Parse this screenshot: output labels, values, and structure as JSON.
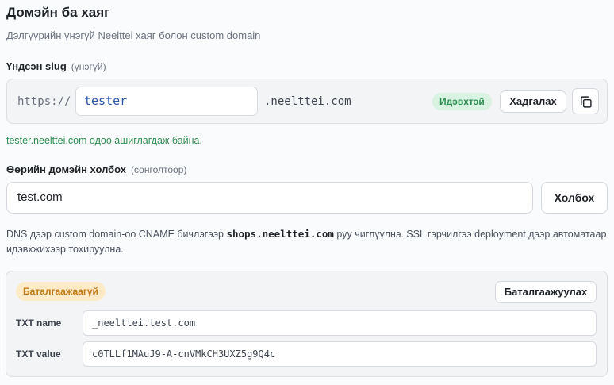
{
  "section": {
    "title": "Домэйн ба хаяг",
    "subtitle": "Дэлгүүрийн үнэгүй Neelttei хаяг болон custom domain"
  },
  "slug": {
    "label": "Үндсэн slug",
    "hint": "(үнэгүй)",
    "prefix": "https://",
    "value": "tester",
    "suffix": ".neelttei.com",
    "status_badge": "Идэвхтэй",
    "save_label": "Хадгалах",
    "status_message": "tester.neelttei.com одоо ашиглагдаж байна."
  },
  "custom_domain": {
    "label": "Өөрийн домэйн холбох",
    "hint": "(сонголтоор)",
    "value": "test.com",
    "connect_label": "Холбох",
    "note_before": "DNS дээр custom domain-оо CNAME бичлэгээр ",
    "note_host": "shops.neelttei.com",
    "note_after": " руу чиглүүлнэ. SSL гэрчилгээ deployment дээр автоматаар идэвхжихээр тохируулна."
  },
  "verification": {
    "status_badge": "Баталгаажаагүй",
    "verify_label": "Баталгаажуулах",
    "records": [
      {
        "label": "TXT name",
        "value": "_neelttei.test.com"
      },
      {
        "label": "TXT value",
        "value": "c0TLLf1MAuJ9-A-cnVMkCH3UXZ5g9Q4c"
      }
    ]
  },
  "colors": {
    "success": "#2f8f53",
    "warning": "#c27a15",
    "link": "#2b55a8"
  },
  "icons": {
    "copy": "copy-icon"
  }
}
